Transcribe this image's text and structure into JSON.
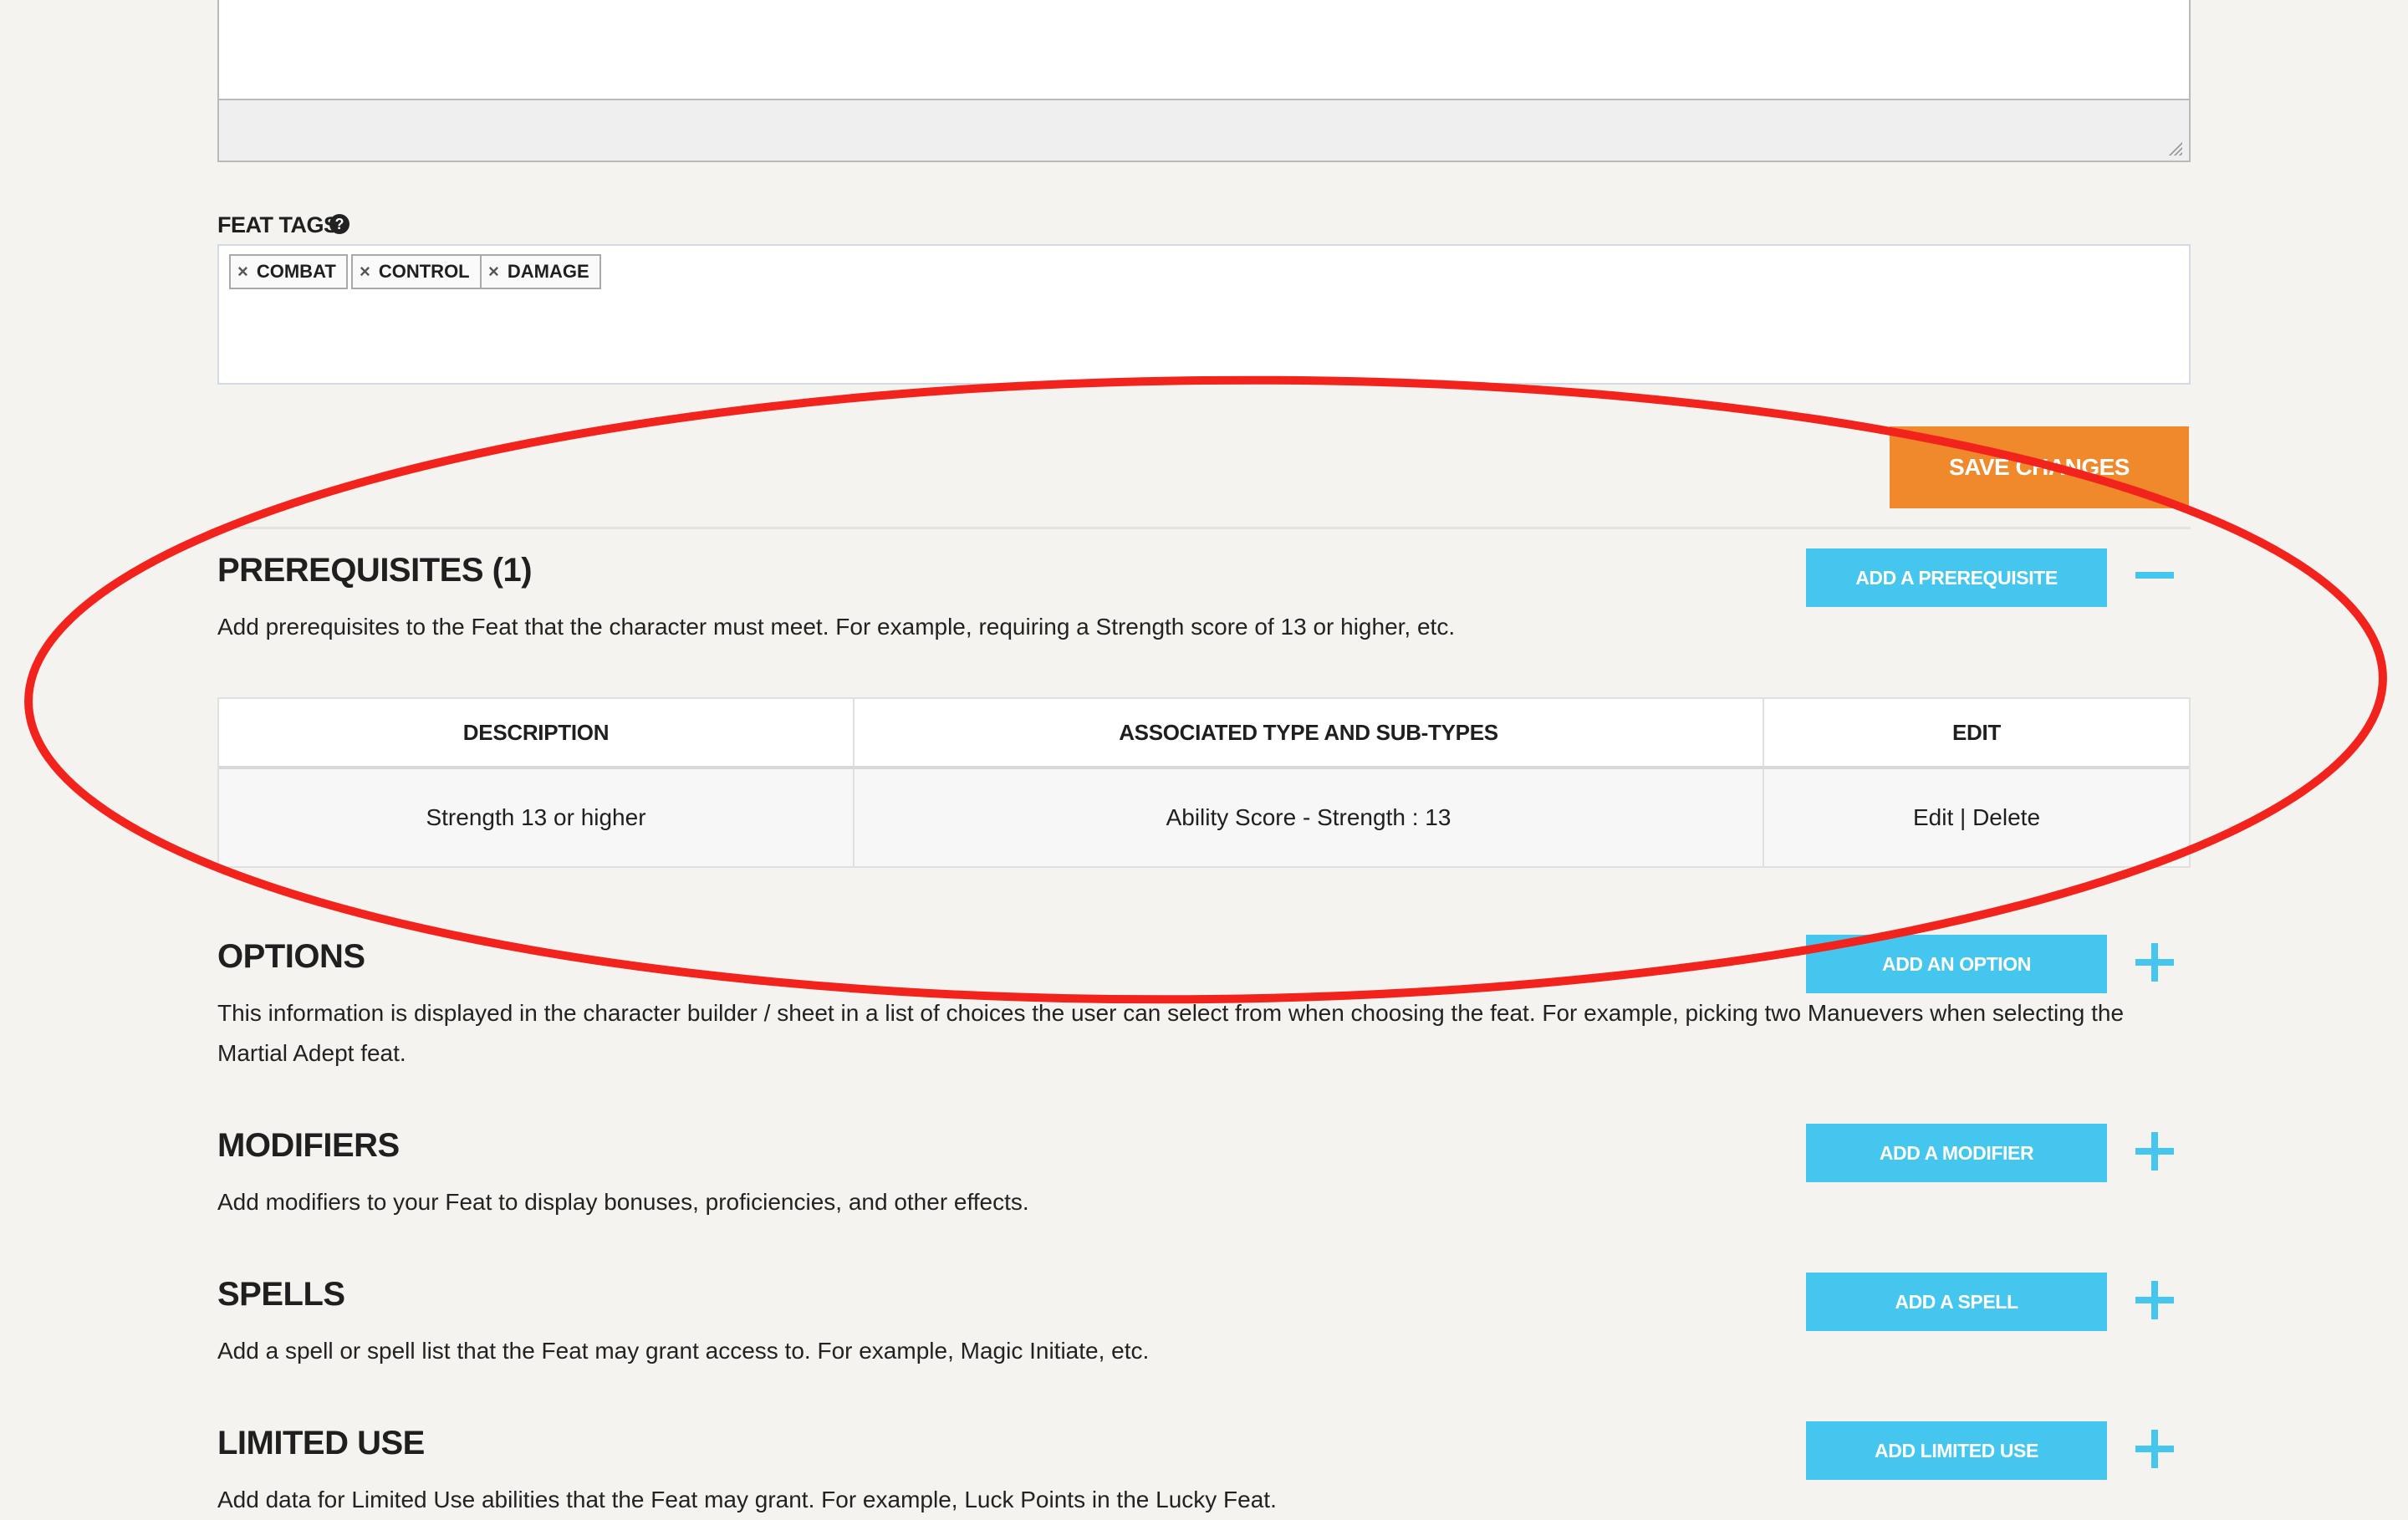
{
  "feat_tags": {
    "label": "FEAT TAGS",
    "help": "?",
    "tags": [
      {
        "remove": "×",
        "label": "COMBAT"
      },
      {
        "remove": "×",
        "label": "CONTROL"
      },
      {
        "remove": "×",
        "label": "DAMAGE"
      }
    ]
  },
  "save_button": "SAVE CHANGES",
  "prerequisites": {
    "title": "PREREQUISITES (1)",
    "description": "Add prerequisites to the Feat that the character must meet. For example, requiring a Strength score of 13 or higher, etc.",
    "button": "ADD A PREREQUISITE",
    "toggle": "minus",
    "table": {
      "headers": [
        "DESCRIPTION",
        "ASSOCIATED TYPE AND SUB-TYPES",
        "EDIT"
      ],
      "rows": [
        {
          "description": "Strength 13 or higher",
          "type": "Ability Score - Strength : 13",
          "edit": "Edit",
          "sep": "|",
          "delete": "Delete"
        }
      ]
    }
  },
  "options": {
    "title": "OPTIONS",
    "description": "This information is displayed in the character builder / sheet in a list of choices the user can select from when choosing the feat. For example, picking two Manuevers when selecting the Martial Adept feat.",
    "button": "ADD AN OPTION",
    "toggle": "plus"
  },
  "modifiers": {
    "title": "MODIFIERS",
    "description": "Add modifiers to your Feat to display bonuses, proficiencies, and other effects.",
    "button": "ADD A MODIFIER",
    "toggle": "plus"
  },
  "spells": {
    "title": "SPELLS",
    "description": "Add a spell or spell list that the Feat may grant access to. For example, Magic Initiate, etc.",
    "button": "ADD A SPELL",
    "toggle": "plus"
  },
  "limited_use": {
    "title": "LIMITED USE",
    "description": "Add data for Limited Use abilities that the Feat may grant. For example, Luck Points in the Lucky Feat.",
    "button": "ADD LIMITED USE",
    "toggle": "plus"
  },
  "colors": {
    "accent_blue": "#45c6ef",
    "save_orange": "#f0892b",
    "annotation_red": "#f2231c",
    "background": "#f5f3ef"
  }
}
